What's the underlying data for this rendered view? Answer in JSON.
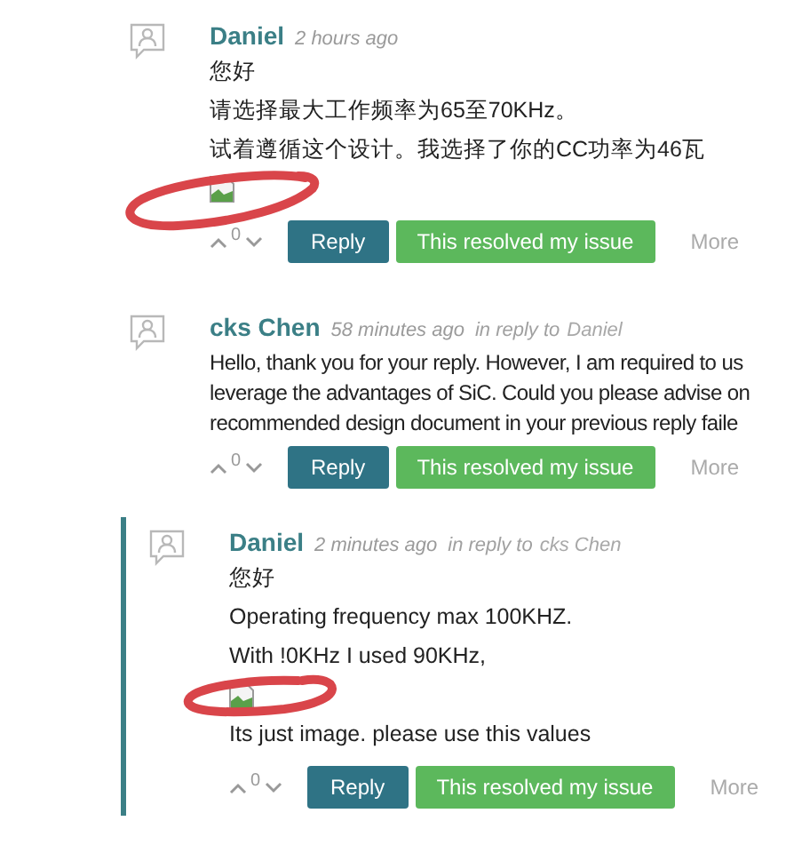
{
  "comments": [
    {
      "nested": false,
      "author": "Daniel",
      "time": "2 hours ago",
      "body": [
        {
          "kind": "text",
          "text": "您好"
        },
        {
          "kind": "text",
          "text": "请选择最大工作频率为65至70KHz。"
        },
        {
          "kind": "text",
          "text": "试着遵循这个设计。我选择了你的CC功率为46瓦"
        },
        {
          "kind": "image"
        }
      ],
      "votes": "0",
      "buttons": {
        "reply": "Reply",
        "resolved": "This resolved my issue",
        "more": "More"
      }
    },
    {
      "nested": false,
      "author": "cks Chen",
      "time": "58 minutes ago",
      "reply_label": "in reply to",
      "reply_to": "Daniel",
      "body": [
        {
          "kind": "line",
          "text": "Hello, thank you for your reply. However, I am required to us"
        },
        {
          "kind": "line",
          "text": "leverage the advantages of SiC. Could you please advise on"
        },
        {
          "kind": "line",
          "text": "recommended design document in your previous reply faile"
        }
      ],
      "votes": "0",
      "buttons": {
        "reply": "Reply",
        "resolved": "This resolved my issue",
        "more": "More"
      }
    },
    {
      "nested": true,
      "author": "Daniel",
      "time": "2 minutes ago",
      "reply_label": "in reply to",
      "reply_to": "cks Chen",
      "body": [
        {
          "kind": "text",
          "text": "您好"
        },
        {
          "kind": "text",
          "text": "Operating frequency max 100KHZ."
        },
        {
          "kind": "text",
          "text": "With !0KHz I used 90KHz,"
        },
        {
          "kind": "image"
        },
        {
          "kind": "text",
          "text": "Its just image. please use this values"
        }
      ],
      "votes": "0",
      "buttons": {
        "reply": "Reply",
        "resolved": "This resolved my issue",
        "more": "More"
      }
    }
  ]
}
